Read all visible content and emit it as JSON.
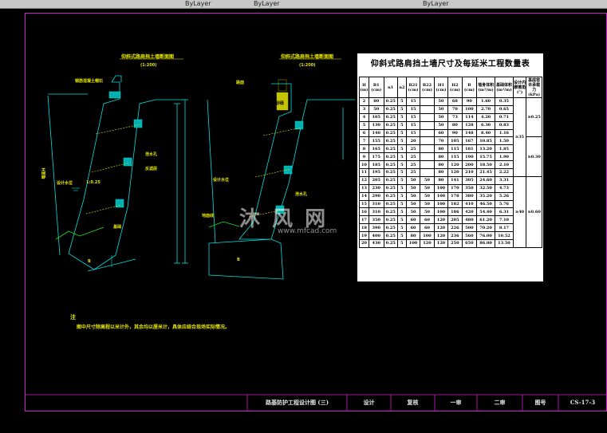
{
  "toolbar": {
    "item_1": "ByLayer",
    "item_2": "ByLayer",
    "item_3": "ByLayer"
  },
  "left_view": {
    "title": "仰斜式路肩挡土墙断面图",
    "scale": "(1:200)"
  },
  "right_view": {
    "title": "仰斜式路肩挡土墙断面图",
    "scale": "(1:200)"
  },
  "table": {
    "title": "仰斜式路肩挡土墙尺寸及每延米工程数量表",
    "headers": [
      "H (m)",
      "B1 (cm)",
      "n1",
      "n2",
      "B21 (cm)",
      "B22 (cm)",
      "H1 (cm)",
      "H2 (cm)",
      "B (cm)",
      "墙身体积 (m³/m)",
      "基础体积 (m³/m)",
      "设计内摩擦角 (°)",
      "基底容许承载力 (kPa)"
    ],
    "rows": [
      [
        "2",
        "80",
        "0.25",
        "5",
        "15",
        "",
        "50",
        "68",
        "90",
        "1.60",
        "0.35"
      ],
      [
        "3",
        "50",
        "0.25",
        "5",
        "15",
        "",
        "50",
        "70",
        "100",
        "2.70",
        "0.65"
      ],
      [
        "4",
        "105",
        "0.25",
        "5",
        "15",
        "",
        "50",
        "73",
        "114",
        "4.20",
        "0.71"
      ],
      [
        "5",
        "130",
        "0.25",
        "5",
        "15",
        "",
        "50",
        "80",
        "128",
        "6.30",
        "0.83"
      ],
      [
        "6",
        "140",
        "0.25",
        "5",
        "15",
        "",
        "60",
        "90",
        "148",
        "8.40",
        "1.16"
      ],
      [
        "7",
        "155",
        "0.25",
        "5",
        "20",
        "",
        "70",
        "105",
        "167",
        "10.85",
        "1.50"
      ],
      [
        "8",
        "165",
        "0.25",
        "5",
        "25",
        "",
        "80",
        "115",
        "181",
        "13.20",
        "1.85"
      ],
      [
        "9",
        "175",
        "0.25",
        "5",
        "25",
        "",
        "80",
        "115",
        "190",
        "15.75",
        "1.90"
      ],
      [
        "10",
        "185",
        "0.25",
        "5",
        "25",
        "",
        "80",
        "120",
        "200",
        "18.50",
        "2.10"
      ],
      [
        "11",
        "195",
        "0.25",
        "5",
        "25",
        "",
        "80",
        "120",
        "210",
        "21.45",
        "2.22"
      ],
      [
        "12",
        "205",
        "0.25",
        "5",
        "50",
        "50",
        "80",
        "141",
        "305",
        "24.60",
        "3.31"
      ],
      [
        "13",
        "230",
        "0.25",
        "5",
        "50",
        "50",
        "100",
        "170",
        "350",
        "32.50",
        "4.73"
      ],
      [
        "14",
        "290",
        "0.25",
        "5",
        "50",
        "50",
        "100",
        "178",
        "380",
        "35.20",
        "5.26"
      ],
      [
        "15",
        "310",
        "0.25",
        "5",
        "50",
        "50",
        "100",
        "182",
        "410",
        "46.50",
        "5.76"
      ],
      [
        "16",
        "310",
        "0.25",
        "5",
        "50",
        "50",
        "100",
        "186",
        "420",
        "54.40",
        "6.31"
      ],
      [
        "17",
        "350",
        "0.25",
        "5",
        "60",
        "60",
        "120",
        "205",
        "480",
        "61.20",
        "7.10"
      ],
      [
        "18",
        "390",
        "0.25",
        "5",
        "60",
        "60",
        "120",
        "226",
        "500",
        "70.20",
        "8.17"
      ],
      [
        "19",
        "400",
        "0.25",
        "5",
        "80",
        "100",
        "120",
        "236",
        "560",
        "76.00",
        "10.52"
      ],
      [
        "20",
        "430",
        "0.25",
        "5",
        "100",
        "120",
        "120",
        "250",
        "650",
        "86.00",
        "13.50"
      ]
    ],
    "friction_groups": [
      {
        "text": "≥35",
        "rows": 10
      },
      {
        "text": "≥40",
        "rows": 9
      }
    ],
    "bearing_groups": [
      {
        "text": "≥0.25",
        "rows": 5
      },
      {
        "text": "≥0.30",
        "rows": 5
      },
      {
        "text": "≥0.60",
        "rows": 9
      }
    ]
  },
  "notes": {
    "heading": "注",
    "body": "图中尺寸除高程以米计外，其余均以厘米计，具体应结合现场实际情况。"
  },
  "title_block": {
    "drawing_name": "路基防护工程设计图 (三)",
    "designed": "设计",
    "reviewed": "复核",
    "sheet_1": "一审",
    "sheet_2": "二审",
    "drawing_no_label": "图号",
    "drawing_no": "CS-17-3"
  },
  "labels": {
    "left_cap": "钢筋混凝土帽石",
    "right_cap": "路面",
    "water_level": "设计水位",
    "weep_hole": "泄水孔",
    "filter": "反滤层",
    "foundation": "基础",
    "slope_ratio": "1:0.25",
    "height": "墙高H",
    "width_b": "B",
    "backfill": "砂砾",
    "ground": "地面线"
  },
  "watermark": {
    "text": "沐 风 网",
    "url": "www.mfcad.com"
  },
  "colors": {
    "background": "#000000",
    "frame": "#d020d0",
    "line_cyan": "#00e0e0",
    "line_green": "#20e020",
    "text_yellow": "#e6e600",
    "table_bg": "#ffffff"
  }
}
